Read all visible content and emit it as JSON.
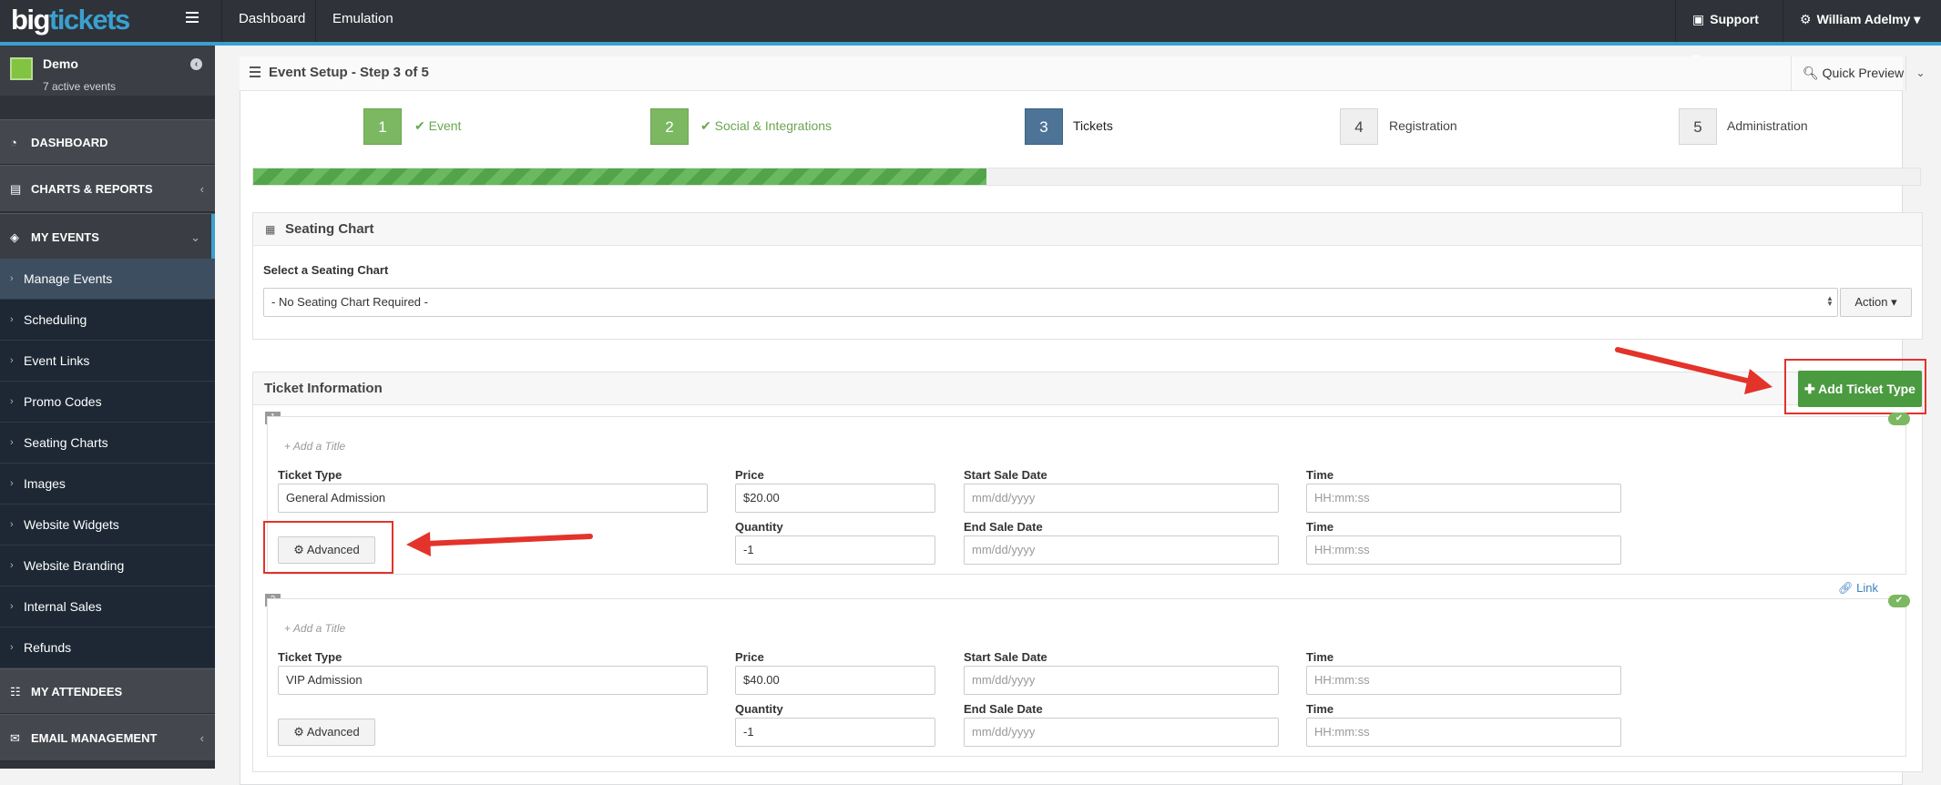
{
  "topbar": {
    "logo_big": "big",
    "logo_tickets": "tickets",
    "nav": [
      "Dashboard",
      "Emulation"
    ],
    "support": "Support",
    "user": "William Adelmy"
  },
  "sidebar": {
    "account_name": "Demo",
    "account_sub": "7 active events",
    "main_items": [
      {
        "label": "DASHBOARD",
        "icon": "dashboard-icon"
      },
      {
        "label": "CHARTS & REPORTS",
        "icon": "chart-icon"
      },
      {
        "label": "MY EVENTS",
        "icon": "ticket-icon"
      },
      {
        "label": "MY ATTENDEES",
        "icon": "users-icon"
      },
      {
        "label": "EMAIL MANAGEMENT",
        "icon": "envelope-icon"
      }
    ],
    "sub_items": [
      "Manage Events",
      "Scheduling",
      "Event Links",
      "Promo Codes",
      "Seating Charts",
      "Images",
      "Website Widgets",
      "Website Branding",
      "Internal Sales",
      "Refunds"
    ]
  },
  "panel": {
    "title": "Event Setup - Step 3 of 5",
    "quick_preview": "Quick Preview"
  },
  "steps": [
    {
      "num": "1",
      "label": "Event",
      "state": "done"
    },
    {
      "num": "2",
      "label": "Social & Integrations",
      "state": "done"
    },
    {
      "num": "3",
      "label": "Tickets",
      "state": "current"
    },
    {
      "num": "4",
      "label": "Registration",
      "state": "todo"
    },
    {
      "num": "5",
      "label": "Administration",
      "state": "todo"
    }
  ],
  "progress": 0.44,
  "seating": {
    "title": "Seating Chart",
    "select_label": "Select a Seating Chart",
    "selected": "- No Seating Chart Required -",
    "action": "Action"
  },
  "tickets": {
    "title": "Ticket Information",
    "add_button": "Add Ticket Type",
    "link_label": "Link",
    "labels": {
      "add_title": "+ Add a Title",
      "ticket_type": "Ticket Type",
      "price": "Price",
      "quantity": "Quantity",
      "start_sale": "Start Sale Date",
      "end_sale": "End Sale Date",
      "time": "Time",
      "advanced": "Advanced",
      "date_placeholder": "mm/dd/yyyy",
      "time_placeholder": "HH:mm:ss"
    },
    "items": [
      {
        "num": "1",
        "type": "General Admission",
        "price": "$20.00",
        "quantity": "-1"
      },
      {
        "num": "2",
        "type": "VIP Admission",
        "price": "$40.00",
        "quantity": "-1"
      }
    ]
  },
  "colors": {
    "topbar": "#2f3238",
    "accent": "#3aa0cf",
    "step_done": "#7cb861",
    "step_current": "#4d7396",
    "add_button": "#4a9a3f",
    "annotation": "#e3332a"
  }
}
